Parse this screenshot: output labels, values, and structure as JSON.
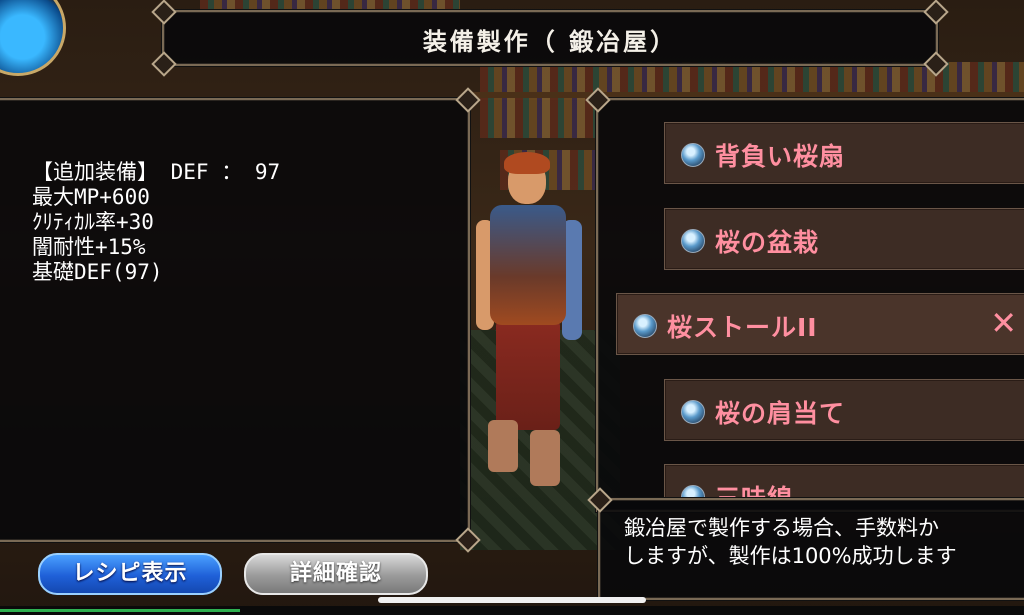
{
  "header": {
    "title": "装備製作（ 鍛冶屋）"
  },
  "equipment_stats": {
    "rows": [
      "【追加装備】 DEF ： 97",
      "最大MP+600",
      "ｸﾘﾃｨｶﾙ率+30",
      "闇耐性+15%",
      "基礎DEF(97)"
    ]
  },
  "recipe_list": {
    "items": [
      {
        "label": "背負い桜扇",
        "icon": "potion-icon",
        "selected": false
      },
      {
        "label": "桜の盆栽",
        "icon": "potion-icon",
        "selected": false
      },
      {
        "label": "桜ストールII",
        "icon": "potion-icon",
        "selected": true,
        "remove": "✕"
      },
      {
        "label": "桜の肩当て",
        "icon": "potion-icon",
        "selected": false
      },
      {
        "label": "三味線",
        "icon": "potion-icon",
        "selected": false
      }
    ],
    "label_color": "#ff8fa0"
  },
  "message": {
    "line1": "鍛冶屋で製作する場合、手数料か",
    "line2": "しますが、製作は100%成功します"
  },
  "buttons": {
    "recipe": "レシピ表示",
    "detail": "詳細確認"
  },
  "colors": {
    "recipe_button": "#1f60d8",
    "detail_button": "#9a9a9a",
    "panel_border": "#7a6a55"
  }
}
